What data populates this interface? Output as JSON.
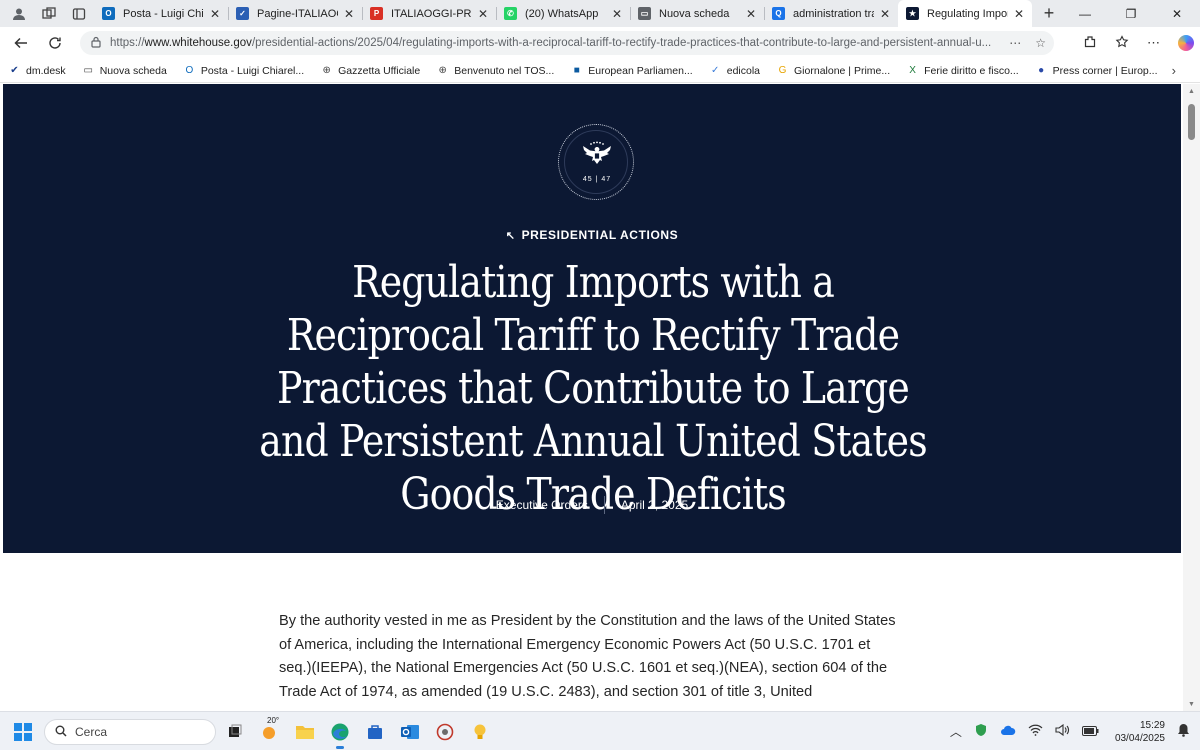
{
  "browser": {
    "tabs": [
      {
        "title": "Posta - Luigi Chiarelli",
        "fav_color": "#0f6cbd",
        "fav_text": "O",
        "active": false
      },
      {
        "title": "Pagine-ITALIAOGGI-",
        "fav_color": "#2b5fb4",
        "fav_text": "✓",
        "active": false
      },
      {
        "title": "ITALIAOGGI-PRIMO P",
        "fav_color": "#d93025",
        "fav_text": "P",
        "active": false
      },
      {
        "title": "(20) WhatsApp",
        "fav_color": "#25d366",
        "fav_text": "✆",
        "active": false
      },
      {
        "title": "Nuova scheda",
        "fav_color": "#5f6368",
        "fav_text": "▭",
        "active": false
      },
      {
        "title": "administration trade",
        "fav_color": "#1a73e8",
        "fav_text": "Q",
        "active": false
      },
      {
        "title": "Regulating Imports w",
        "fav_color": "#0c1833",
        "fav_text": "★",
        "active": true
      }
    ],
    "url_prefix": "https://",
    "url_host": "www.whitehouse.gov",
    "url_path": "/presidential-actions/2025/04/regulating-imports-with-a-reciprocal-tariff-to-rectify-trade-practices-that-contribute-to-large-and-persistent-annual-u...",
    "bookmarks": [
      {
        "label": "dm.desk",
        "icon": "✔",
        "icon_color": "#1a3e8c"
      },
      {
        "label": "Nuova scheda",
        "icon": "▭",
        "icon_color": "#444444"
      },
      {
        "label": "Posta - Luigi Chiarel...",
        "icon": "O",
        "icon_color": "#0f6cbd"
      },
      {
        "label": "Gazzetta Ufficiale",
        "icon": "⊕",
        "icon_color": "#444444"
      },
      {
        "label": "Benvenuto nel TOS...",
        "icon": "⊕",
        "icon_color": "#444444"
      },
      {
        "label": "European Parliamen...",
        "icon": "■",
        "icon_color": "#0b5aa0"
      },
      {
        "label": "edicola",
        "icon": "✓",
        "icon_color": "#3c7dd9"
      },
      {
        "label": "Giornalone | Prime...",
        "icon": "G",
        "icon_color": "#e7a400"
      },
      {
        "label": "Ferie diritto e fisco...",
        "icon": "X",
        "icon_color": "#1d7a3a"
      },
      {
        "label": "Press corner | Europ...",
        "icon": "●",
        "icon_color": "#2a4aa8"
      }
    ]
  },
  "hero": {
    "seal_numbers": "45 | 47",
    "kicker": "PRESIDENTIAL ACTIONS",
    "title": "Regulating Imports with a Reciprocal Tariff to Rectify Trade Practices that Contribute to Large and Persistent Annual United States Goods Trade Deficits",
    "category": "Executive Orders",
    "date": "April 2, 2025",
    "background_color": "#0c1833"
  },
  "article": {
    "first_paragraph": "By the authority vested in me as President by the Constitution and the laws of the United States of America, including the International Emergency Economic Powers Act (50 U.S.C. 1701 et seq.)(IEEPA), the National Emergencies Act (50 U.S.C. 1601 et seq.)(NEA), section 604 of the Trade Act of 1974, as amended (19 U.S.C. 2483), and section 301 of title 3, United"
  },
  "taskbar": {
    "search_placeholder": "Cerca",
    "weather_temp": "20°",
    "time": "15:29",
    "date": "03/04/2025"
  }
}
